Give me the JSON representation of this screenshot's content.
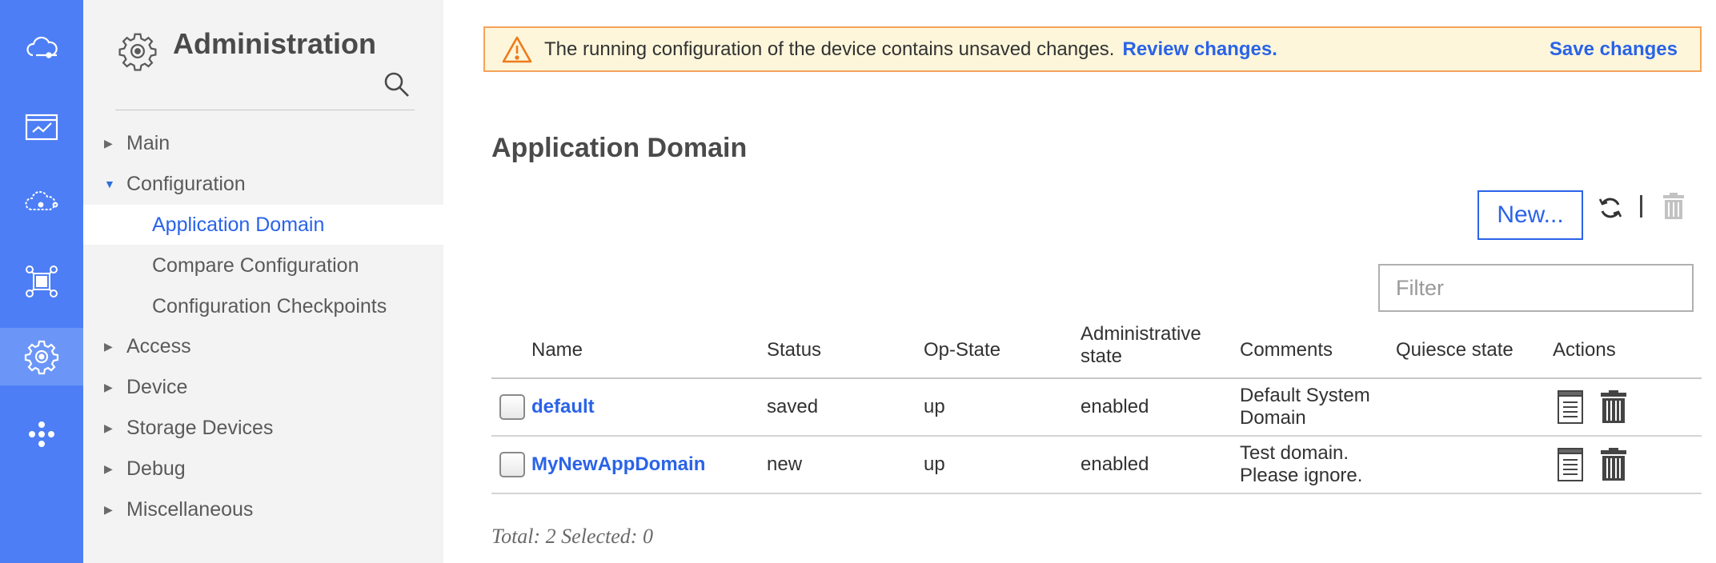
{
  "rail": {
    "items": [
      {
        "icon": "cloud-connect-icon"
      },
      {
        "icon": "monitor-chart-icon"
      },
      {
        "icon": "cloud-network-icon"
      },
      {
        "icon": "network-topology-icon"
      },
      {
        "icon": "gear-icon",
        "active": true
      },
      {
        "icon": "apps-dots-icon"
      }
    ]
  },
  "nav": {
    "title": "Administration",
    "items": [
      {
        "label": "Main",
        "level": 1,
        "expanded": false
      },
      {
        "label": "Configuration",
        "level": 1,
        "expanded": true
      },
      {
        "label": "Application Domain",
        "level": 2,
        "selected": true
      },
      {
        "label": "Compare Configuration",
        "level": 2
      },
      {
        "label": "Configuration Checkpoints",
        "level": 2
      },
      {
        "label": "Access",
        "level": 1,
        "expanded": false
      },
      {
        "label": "Device",
        "level": 1,
        "expanded": false
      },
      {
        "label": "Storage Devices",
        "level": 1,
        "expanded": false
      },
      {
        "label": "Debug",
        "level": 1,
        "expanded": false
      },
      {
        "label": "Miscellaneous",
        "level": 1,
        "expanded": false
      }
    ]
  },
  "banner": {
    "message": "The running configuration of the device contains unsaved changes.",
    "review_link": "Review changes.",
    "save_link": "Save changes"
  },
  "page": {
    "title": "Application Domain"
  },
  "toolbar": {
    "new_label": "New..."
  },
  "filter": {
    "placeholder": "Filter",
    "value": ""
  },
  "table": {
    "columns": {
      "name": "Name",
      "status": "Status",
      "opstate": "Op-State",
      "admin_line1": "Administrative",
      "admin_line2": "state",
      "comments": "Comments",
      "quiesce": "Quiesce state",
      "actions": "Actions"
    },
    "rows": [
      {
        "name": "default",
        "status": "saved",
        "opstate": "up",
        "admin": "enabled",
        "comment_line1": "Default System",
        "comment_line2": "Domain",
        "quiesce": "",
        "checked": false
      },
      {
        "name": "MyNewAppDomain",
        "status": "new",
        "opstate": "up",
        "admin": "enabled",
        "comment_line1": "Test domain.",
        "comment_line2": "Please ignore.",
        "quiesce": "",
        "checked": false
      }
    ]
  },
  "footer": {
    "summary": "Total: 2 Selected: 0"
  },
  "colors": {
    "rail": "#4d7ef5",
    "accent": "#2a63e8",
    "banner_bg": "#fdf6da",
    "banner_border": "#f5a35a"
  }
}
